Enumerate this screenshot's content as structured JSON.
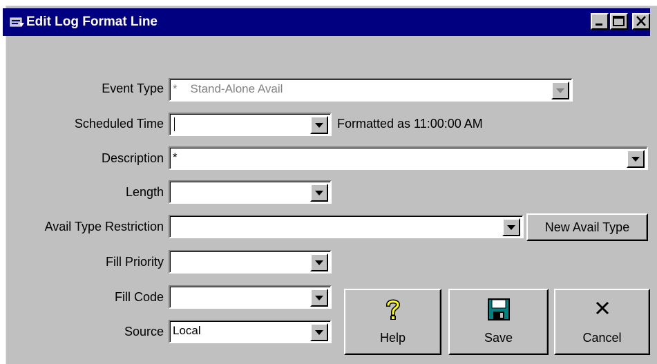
{
  "window": {
    "title": "Edit Log Format Line"
  },
  "fields": {
    "event_type": {
      "label": "Event Type",
      "value": "*    Stand-Alone Avail"
    },
    "scheduled_time": {
      "label": "Scheduled Time",
      "value": "",
      "note": "Formatted as 11:00:00 AM"
    },
    "description": {
      "label": "Description",
      "value": "*"
    },
    "length": {
      "label": "Length",
      "value": ""
    },
    "avail_type_restriction": {
      "label": "Avail Type Restriction",
      "value": ""
    },
    "fill_priority": {
      "label": "Fill Priority",
      "value": ""
    },
    "fill_code": {
      "label": "Fill Code",
      "value": ""
    },
    "source": {
      "label": "Source",
      "value": "Local"
    }
  },
  "buttons": {
    "new_avail_type": "New Avail Type",
    "help": "Help",
    "save": "Save",
    "cancel": "Cancel"
  },
  "colors": {
    "titlebar": "#000080",
    "face": "#c0c0c0",
    "help_icon": "#ffff00"
  }
}
